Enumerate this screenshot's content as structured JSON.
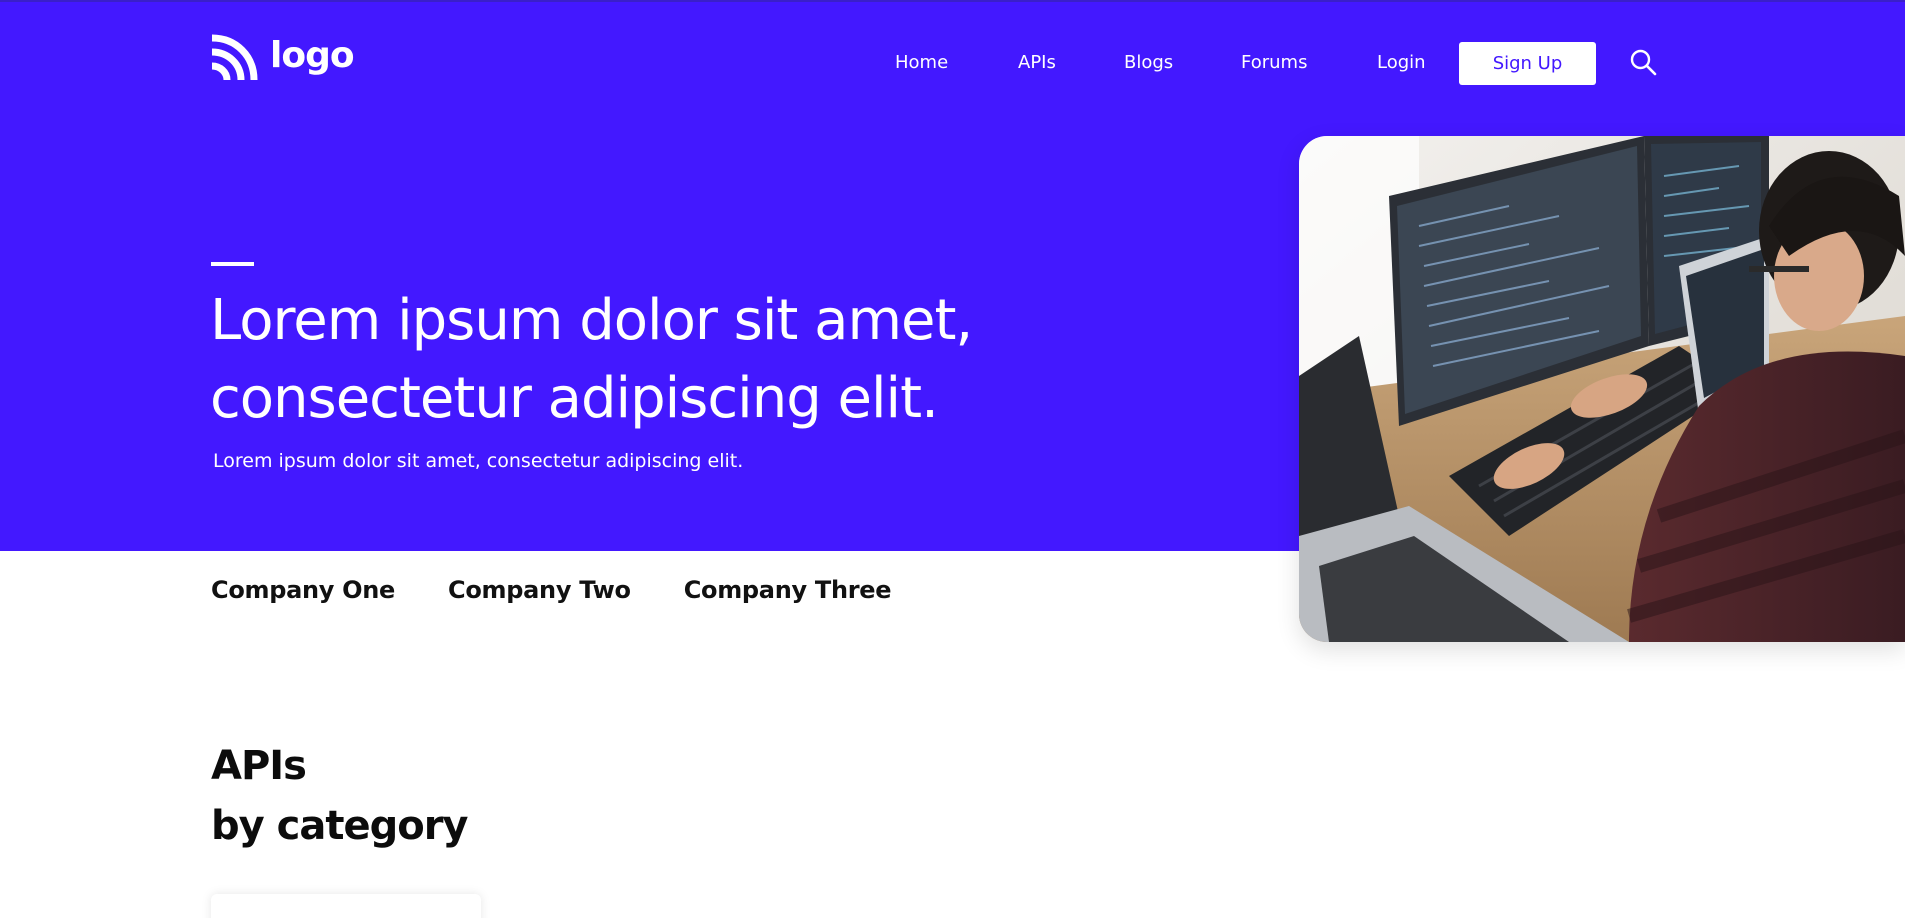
{
  "header": {
    "logo_text": "logo",
    "nav": {
      "home": "Home",
      "apis": "APIs",
      "blogs": "Blogs",
      "forums": "Forums",
      "login": "Login"
    },
    "signup_label": "Sign Up",
    "search_icon": "search-icon"
  },
  "hero": {
    "title": "Lorem ipsum dolor sit amet, consectetur adipiscing elit.",
    "subtitle": "Lorem ipsum dolor sit amet, consectetur adipiscing elit.",
    "image_icon": "developer-workstation-photo"
  },
  "companies": [
    "Company One",
    "Company Two",
    "Company Three"
  ],
  "apis_section": {
    "title_line1": "APIs",
    "title_line2": "by category"
  },
  "colors": {
    "brand": "#4318ff",
    "text_dark": "#0c0c0c",
    "white": "#ffffff"
  }
}
